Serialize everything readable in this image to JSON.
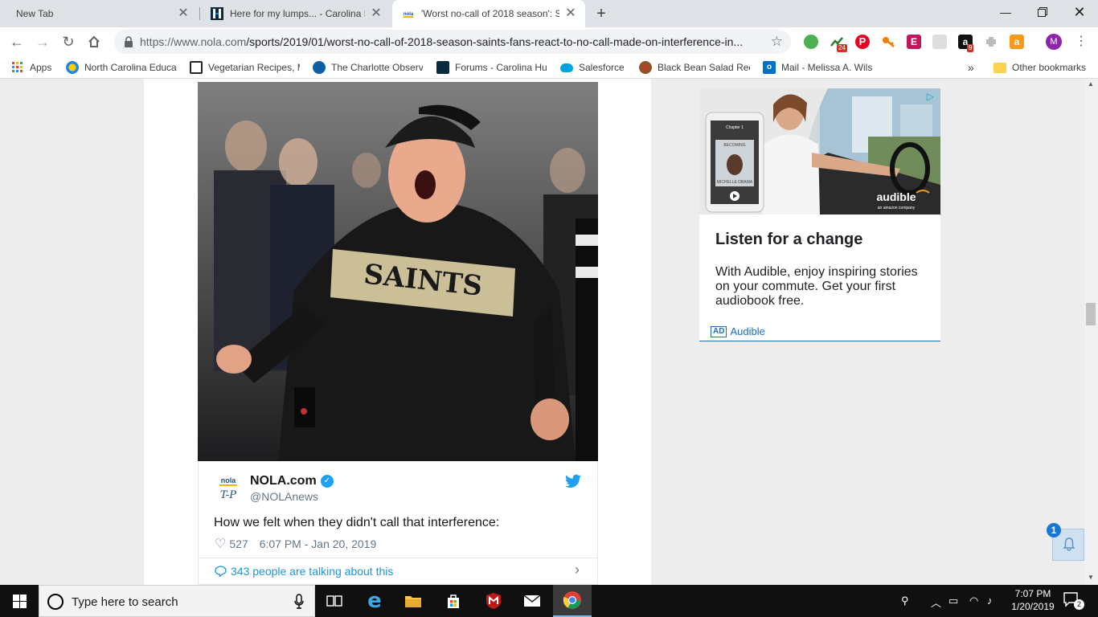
{
  "tabs": [
    {
      "title": "New Tab"
    },
    {
      "title": "Here for my lumps... - Carolina Pa"
    },
    {
      "title": "'Worst no-call of 2018 season': Sa"
    }
  ],
  "address": {
    "url_host": "https://www.nola.com",
    "url_path": "/sports/2019/01/worst-no-call-of-2018-season-saints-fans-react-to-no-call-made-on-interference-in..."
  },
  "extensions": {
    "badge_1": "24",
    "badge_2": "9"
  },
  "profile_initial": "M",
  "bookmarks": [
    {
      "label": "Apps"
    },
    {
      "label": "North Carolina Educa"
    },
    {
      "label": "Vegetarian Recipes, M"
    },
    {
      "label": "The Charlotte Observ"
    },
    {
      "label": "Forums - Carolina Hu"
    },
    {
      "label": "Salesforce"
    },
    {
      "label": "Black Bean Salad Rec"
    },
    {
      "label": "Mail - Melissa A. Wils"
    }
  ],
  "bookmarks_more": "»",
  "other_bookmarks": "Other bookmarks",
  "photo": {
    "shirt_text": "SAINTS"
  },
  "tweet": {
    "name": "NOLA.com",
    "handle": "@NOLAnews",
    "text": "How we felt when they didn't call that interference:",
    "likes": "527",
    "time": "6:07 PM - Jan 20, 2019",
    "talking": "343 people are talking about this",
    "avatar_top": "nola",
    "avatar_bottom": "T-P"
  },
  "ad": {
    "headline": "Listen for a change",
    "body": "With Audible, enjoy inspiring stories on your commute. Get your first audiobook free.",
    "ad_tag": "AD",
    "advertiser": "Audible",
    "brand_logo": "audible",
    "brand_sub": "an amazon company",
    "book_title_1": "BECOMING",
    "book_title_2": "MICHELLE OBAMA",
    "chapter_label": "Chapter 1"
  },
  "notification": {
    "count": "1"
  },
  "taskbar": {
    "search_placeholder": "Type here to search",
    "time": "7:07 PM",
    "date": "1/20/2019",
    "action_center_count": "2"
  },
  "colors": {
    "chrome_tabstrip": "#dee1e6",
    "twitter_blue": "#1da1f2",
    "audible_orange": "#f7991c",
    "link_blue": "#1a6ebd"
  }
}
